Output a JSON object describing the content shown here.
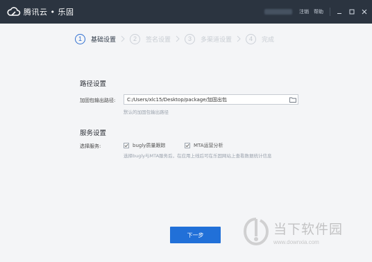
{
  "titlebar": {
    "brand": "腾讯云 • 乐固",
    "logout": "注销",
    "help": "帮助",
    "logo_icon": "tencent-cloud-logo",
    "window_buttons": [
      "minimize-icon",
      "maximize-icon",
      "close-icon"
    ]
  },
  "steps": [
    {
      "num": "1",
      "label": "基础设置",
      "active": true
    },
    {
      "num": "2",
      "label": "签名设置",
      "active": false
    },
    {
      "num": "3",
      "label": "多渠道设置",
      "active": false
    },
    {
      "num": "4",
      "label": "完成",
      "active": false
    }
  ],
  "path_section": {
    "title": "路径设置",
    "label": "加固包输出路径:",
    "value": "C:/Users/xlc15/Desktop/package/加固出包",
    "hint": "默认的加固包输出路径"
  },
  "service_section": {
    "title": "服务设置",
    "label": "选择服务:",
    "options": [
      {
        "label": "bugly质量跟踪",
        "checked": true
      },
      {
        "label": "MTA运营分析",
        "checked": true
      }
    ],
    "hint": "选择bugly与MTA服务后，在应用上线后可在乐固网站上查看数据统计信息"
  },
  "next_button": "下一步",
  "watermark": {
    "title": "当下软件园",
    "url": "www.downxia.com"
  },
  "colors": {
    "titlebar": "#2b3440",
    "accent": "#2170d8",
    "background": "#f4f5f7"
  }
}
